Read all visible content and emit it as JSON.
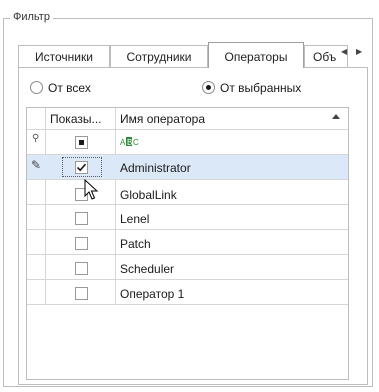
{
  "filter": {
    "title": "Фильтр",
    "tabs": [
      {
        "label": "Источники",
        "active": false
      },
      {
        "label": "Сотрудники",
        "active": false
      },
      {
        "label": "Операторы",
        "active": true
      },
      {
        "label": "Объ",
        "active": false
      }
    ],
    "radios": [
      {
        "label": "От всех",
        "selected": false
      },
      {
        "label": "От выбранных",
        "selected": true
      }
    ],
    "grid": {
      "columns": [
        {
          "label": "Показы..."
        },
        {
          "label": "Имя оператора",
          "sort": "ascending"
        }
      ],
      "filter_row": {
        "show_checkbox_state": "indeterminate",
        "name_filter_icon": "text-filter-icon"
      },
      "rows": [
        {
          "name": "Administrator",
          "checked": true,
          "selected": true,
          "indicator": "edit-pencil-icon"
        },
        {
          "name": "GlobalLink",
          "checked": false
        },
        {
          "name": "Lenel",
          "checked": false
        },
        {
          "name": "Patch",
          "checked": false
        },
        {
          "name": "Scheduler",
          "checked": false
        },
        {
          "name": "Оператор 1",
          "checked": false
        }
      ]
    },
    "colors": {
      "selection": "#dbe8f7",
      "border": "#bdbdbd",
      "accent": "#2e8b3a"
    }
  }
}
